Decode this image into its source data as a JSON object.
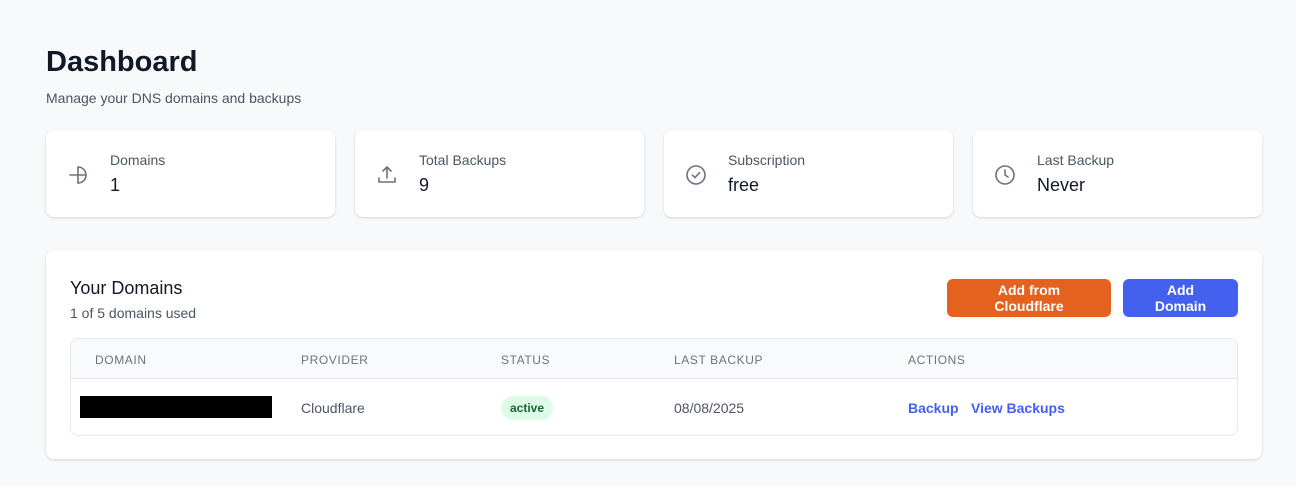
{
  "header": {
    "title": "Dashboard",
    "subtitle": "Manage your DNS domains and backups"
  },
  "stats": [
    {
      "label": "Domains",
      "value": "1",
      "icon": "globe-icon"
    },
    {
      "label": "Total Backups",
      "value": "9",
      "icon": "upload-icon"
    },
    {
      "label": "Subscription",
      "value": "free",
      "icon": "check-circle-icon"
    },
    {
      "label": "Last Backup",
      "value": "Never",
      "icon": "clock-icon"
    }
  ],
  "domains": {
    "title": "Your Domains",
    "usage": "1 of 5 domains used",
    "add_cloudflare_label": "Add from Cloudflare",
    "add_domain_label": "Add Domain",
    "columns": [
      "DOMAIN",
      "PROVIDER",
      "STATUS",
      "LAST BACKUP",
      "ACTIONS"
    ],
    "rows": [
      {
        "domain": "",
        "provider": "Cloudflare",
        "status": "active",
        "last_backup": "08/08/2025",
        "actions": [
          "Backup",
          "View Backups"
        ]
      }
    ]
  },
  "colors": {
    "accent": "#4361ee",
    "cloudflare": "#e4611e",
    "status_active_bg": "#dcfce7",
    "status_active_text": "#166534"
  }
}
